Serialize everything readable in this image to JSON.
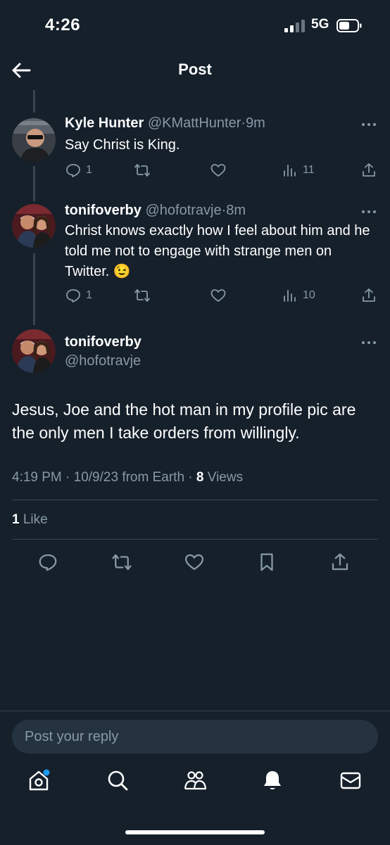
{
  "status_bar": {
    "time": "4:26",
    "network": "5G"
  },
  "header": {
    "title": "Post"
  },
  "thread": [
    {
      "name": "Kyle Hunter",
      "handle": "@KMattHunter",
      "time": "9m",
      "text": "Say Christ is King.",
      "replies": "1",
      "reposts": "",
      "likes": "",
      "views": "11"
    },
    {
      "name": "tonifoverby",
      "handle": "@hofotravje",
      "time": "8m",
      "text": "Christ knows exactly how I feel about him and he told me not to engage with strange men on Twitter. 😉",
      "replies": "1",
      "reposts": "",
      "likes": "",
      "views": "10"
    }
  ],
  "main_post": {
    "name": "tonifoverby",
    "handle": "@hofotravje",
    "text": "Jesus, Joe and the hot man in my profile pic are the only men I take orders from willingly.",
    "timestamp": "4:19 PM · 10/9/23 from Earth · ",
    "views_count": "8",
    "views_label": " Views",
    "likes_count": "1",
    "likes_label": " Like"
  },
  "reply": {
    "placeholder": "Post your reply"
  },
  "tabs": [
    "home-icon",
    "search-icon",
    "communities-icon",
    "notifications-icon",
    "messages-icon"
  ],
  "colors": {
    "background": "#15202b",
    "secondary_text": "#8899a6",
    "divider": "#38444d",
    "accent": "#1d9bf0"
  }
}
